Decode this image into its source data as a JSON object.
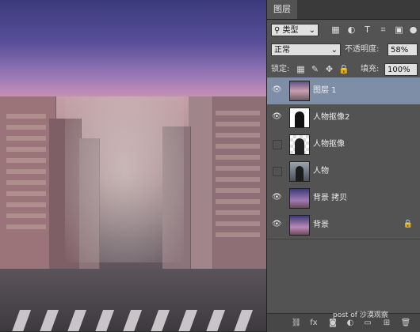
{
  "panel": {
    "tab_label": "图层",
    "filter": {
      "label": "类型"
    },
    "blend_mode": "正常",
    "opacity": {
      "label": "不透明度:",
      "value": "58%"
    },
    "lock_label": "锁定:",
    "fill": {
      "label": "填充:",
      "value": "100%"
    }
  },
  "layers": [
    {
      "name": "图层 1",
      "visible": true,
      "selected": true
    },
    {
      "name": "人物抠像2",
      "visible": true,
      "selected": false
    },
    {
      "name": "人物抠像",
      "visible": false,
      "selected": false
    },
    {
      "name": "人物",
      "visible": false,
      "selected": false
    },
    {
      "name": "背景 拷贝",
      "visible": true,
      "selected": false
    },
    {
      "name": "背景",
      "visible": true,
      "selected": false,
      "locked": true
    }
  ],
  "bottom_bar_icons": [
    "link-icon",
    "fx-icon",
    "mask-icon",
    "adjustment-icon",
    "group-icon",
    "new-layer-icon",
    "trash-icon"
  ],
  "watermark": "post of 沙漠观察"
}
